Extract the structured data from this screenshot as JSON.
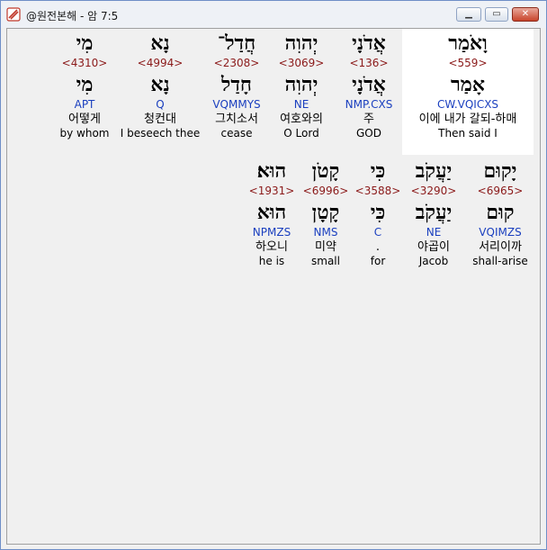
{
  "window": {
    "title": "@원전본해 - 암 7:5",
    "min_label": "▁",
    "max_label": "▭",
    "close_label": "✕"
  },
  "words": [
    {
      "hebrew": "וָאֹמַר",
      "strong": "<559>",
      "lemma": "אָמַר",
      "parse": "CW.VQICXS",
      "korean": "이에 내가 갈되-하매",
      "english": "Then said I",
      "highlight": true
    },
    {
      "hebrew": "אֲדֹנָי",
      "strong": "<136>",
      "lemma": "אֲדֹנָי",
      "parse": "NMP.CXS",
      "korean": "주",
      "english": "GOD"
    },
    {
      "hebrew": "יְהוִה",
      "strong": "<3069>",
      "lemma": "יְהוִה",
      "parse": "NE",
      "korean": "여호와의",
      "english": "O Lord"
    },
    {
      "hebrew": "חֲדַל־",
      "strong": "<2308>",
      "lemma": "חָדַל",
      "parse": "VQMMYS",
      "korean": "그치소서",
      "english": "cease"
    },
    {
      "hebrew": "נָא",
      "strong": "<4994>",
      "lemma": "נָא",
      "parse": "Q",
      "korean": "청컨대",
      "english": "I beseech thee"
    },
    {
      "hebrew": "מִי",
      "strong": "<4310>",
      "lemma": "מִי",
      "parse": "APT",
      "korean": "어떻게",
      "english": "by whom"
    },
    {
      "hebrew": "יָקוּם",
      "strong": "<6965>",
      "lemma": "קוּם",
      "parse": "VQIMZS",
      "korean": "서리이까",
      "english": "shall-arise"
    },
    {
      "hebrew": "יַעֲקֹב",
      "strong": "<3290>",
      "lemma": "יַעֲקֹב",
      "parse": "NE",
      "korean": "야곱이",
      "english": "Jacob"
    },
    {
      "hebrew": "כִּי",
      "strong": "<3588>",
      "lemma": "כִּי",
      "parse": "C",
      "korean": ".",
      "english": "for"
    },
    {
      "hebrew": "קָטֹן",
      "strong": "<6996>",
      "lemma": "קָטָן",
      "parse": "NMS",
      "korean": "미약",
      "english": "small"
    },
    {
      "hebrew": "הוּא׃",
      "strong": "<1931>",
      "lemma": "הוּא",
      "parse": "NPMZS",
      "korean": "하오니",
      "english": "he is"
    }
  ]
}
